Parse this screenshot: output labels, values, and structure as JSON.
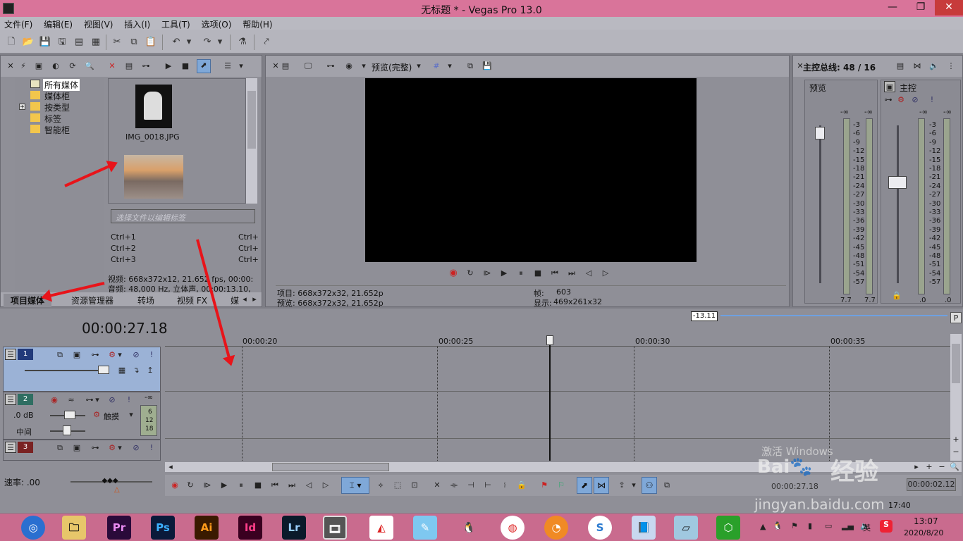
{
  "window": {
    "title": "无标题 * - Vegas Pro 13.0"
  },
  "menu": [
    "文件(F)",
    "编辑(E)",
    "视图(V)",
    "插入(I)",
    "工具(T)",
    "选项(O)",
    "帮助(H)"
  ],
  "media_tree": [
    "所有媒体",
    "媒体柜",
    "按类型",
    "标签",
    "智能柜"
  ],
  "media_files": {
    "file1": "IMG_0018.JPG"
  },
  "tag_placeholder": "选择文件以编辑标签",
  "shortcuts": [
    {
      "left": "Ctrl+1",
      "right": "Ctrl+"
    },
    {
      "left": "Ctrl+2",
      "right": "Ctrl+"
    },
    {
      "left": "Ctrl+3",
      "right": "Ctrl+"
    }
  ],
  "media_info": {
    "video": "视频: 668x372x12, 21.652 fps, 00:00:",
    "audio": "音频: 48,000 Hz, 立体声, 00:00:13.10,"
  },
  "left_tabs": [
    "项目媒体",
    "资源管理器",
    "转场",
    "视频 FX",
    "媒"
  ],
  "preview": {
    "mode": "预览(完整)",
    "project": "项目: 668x372x32, 21.652p",
    "preview": "预览: 668x372x32, 21.652p",
    "frame_label": "帧:",
    "frame_value": "603",
    "display_label": "显示:",
    "display_value": "469x261x32"
  },
  "master": {
    "title": "主控总线: 48 / 16",
    "preview_label": "预览",
    "master_label": "主控",
    "inf": "-∞",
    "scale": [
      "3",
      "6",
      "9",
      "12",
      "15",
      "18",
      "21",
      "24",
      "27",
      "30",
      "33",
      "36",
      "39",
      "42",
      "45",
      "48",
      "51",
      "54",
      "57"
    ],
    "bottom_left_a": "7.7",
    "bottom_left_b": "7.7",
    "bottom_right_a": ".0",
    "bottom_right_b": ".0"
  },
  "timeline": {
    "timecode": "00:00:27.18",
    "region": "-13.11",
    "ticks": [
      "00:00:20",
      "00:00:25",
      "00:00:30",
      "00:00:35"
    ],
    "tracks": [
      "1",
      "2",
      "3"
    ],
    "audio_db": ".0 dB",
    "audio_pan": "中间",
    "audio_mode": "触摸",
    "audio_inf": "-∞",
    "audio_meter": [
      "6",
      "12",
      "18"
    ],
    "rate": "速率: .00",
    "end_time": "00:00:02.12",
    "time_display": "00:00:27.18"
  },
  "watermark": {
    "text": "经验",
    "url": "jingyan.baidu.com",
    "activate": "激活 Windows"
  },
  "taskbar": {
    "apps": [
      "Pr",
      "Ps",
      "Ai",
      "Id",
      "Lr"
    ],
    "ime": "英",
    "time": "13:07",
    "date": "2020/8/20",
    "bottom_time": "17:40"
  },
  "colors": {
    "titlebar": "#d9749a",
    "taskbar": "#c96b8e",
    "arrow": "#e8141a"
  }
}
